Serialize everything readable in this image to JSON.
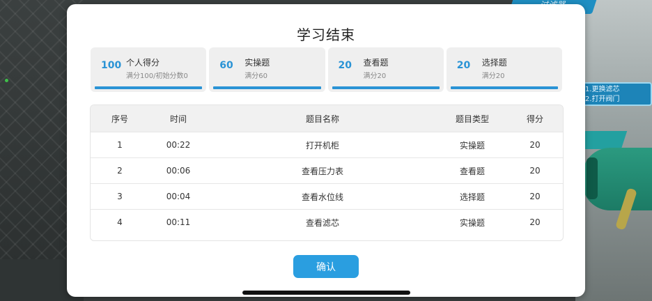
{
  "background": {
    "sign_top": "过滤器",
    "sign_mid_line1": "1.更换滤芯",
    "sign_mid_line2": "2.打开阀门"
  },
  "modal": {
    "title": "学习结束",
    "stats": [
      {
        "value": "100",
        "label": "个人得分",
        "sub": "满分100/初始分数0"
      },
      {
        "value": "60",
        "label": "实操题",
        "sub": "满分60"
      },
      {
        "value": "20",
        "label": "查看题",
        "sub": "满分20"
      },
      {
        "value": "20",
        "label": "选择题",
        "sub": "满分20"
      }
    ],
    "table": {
      "headers": [
        "序号",
        "时间",
        "题目名称",
        "题目类型",
        "得分"
      ],
      "rows": [
        [
          "1",
          "00:22",
          "打开机柜",
          "实操题",
          "20"
        ],
        [
          "2",
          "00:06",
          "查看压力表",
          "查看题",
          "20"
        ],
        [
          "3",
          "00:04",
          "查看水位线",
          "选择题",
          "20"
        ],
        [
          "4",
          "00:11",
          "查看滤芯",
          "实操题",
          "20"
        ]
      ]
    },
    "confirm_label": "确认"
  },
  "colors": {
    "accent": "#2a93d5",
    "button": "#2a9ee0",
    "card_bg": "#efefef",
    "header_bg": "#f1f1f1"
  }
}
